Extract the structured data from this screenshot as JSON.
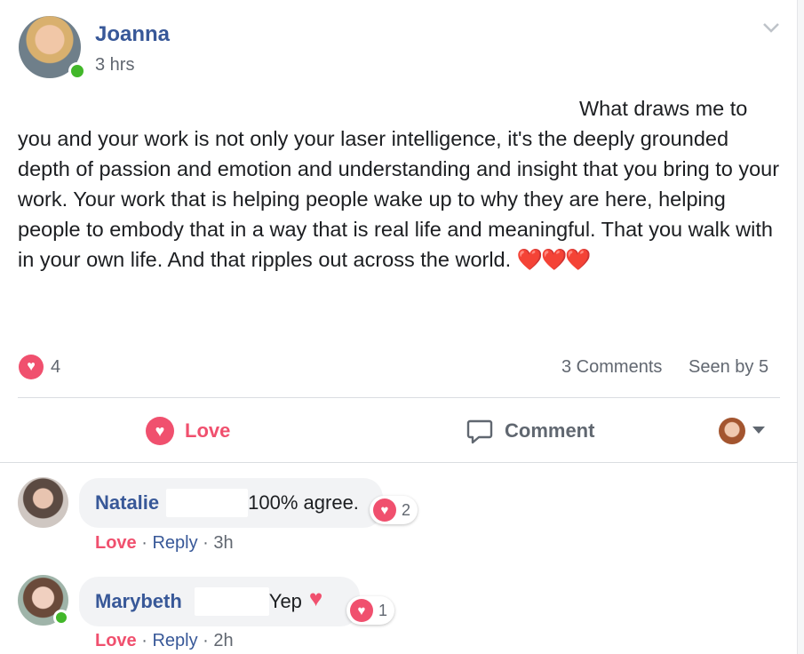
{
  "post": {
    "author": "Joanna",
    "time": "3 hrs",
    "text": "What draws me to you and your work is not only your laser intelligence, it's the deeply grounded depth of passion and emotion and understanding and insight that you bring to your work. Your work that is helping people wake up to why they are here, helping people to embody that in a way that is real life and meaningful. That you walk with in your own life. And that ripples out across the world.",
    "emoji": "❤️❤️❤️",
    "reaction_count": "4",
    "comments_count": "3 Comments",
    "seen_by": "Seen by 5"
  },
  "actions": {
    "love_label": "Love",
    "comment_label": "Comment"
  },
  "comments": [
    {
      "author": "Natalie",
      "text": "100% agree.",
      "reactions": "2",
      "love": "Love",
      "reply": "Reply",
      "time": "3h"
    },
    {
      "author": "Marybeth",
      "text": "Yep",
      "reactions": "1",
      "love": "Love",
      "reply": "Reply",
      "time": "2h"
    }
  ],
  "colors": {
    "link_blue": "#385898",
    "love_red": "#f0506e",
    "online_green": "#42b72a",
    "meta_gray": "#616770"
  },
  "icons": {
    "menu": "chevron-down-icon",
    "reaction": "heart-icon",
    "comment": "speech-bubble-icon",
    "audience": "profile-avatar-dropdown"
  }
}
